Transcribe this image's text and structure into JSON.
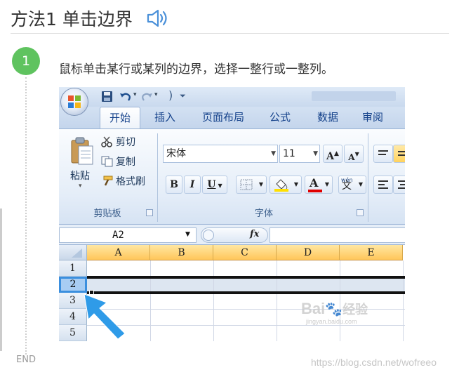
{
  "header": {
    "title": "方法1 单击边界"
  },
  "step": {
    "number": "1",
    "text": "鼠标单击某行或某列的边界，选择一整行或一整列。",
    "end_label": "END"
  },
  "watermark": {
    "url": "https://blog.csdn.net/wofreeo",
    "baidu": "Bai",
    "baidu_cn": "经验",
    "baidu_sub": "jingyan.baidu.com"
  },
  "excel": {
    "tabs": [
      "开始",
      "插入",
      "页面布局",
      "公式",
      "数据",
      "审阅"
    ],
    "active_tab": "开始",
    "clipboard": {
      "paste": "粘贴",
      "cut": "剪切",
      "copy": "复制",
      "format_painter": "格式刷",
      "group_label": "剪贴板"
    },
    "font": {
      "name": "宋体",
      "size": "11",
      "grow": "A",
      "shrink": "A",
      "bold": "B",
      "italic": "I",
      "underline": "U",
      "font_color": "A",
      "phonetic": "wén",
      "phonetic_char": "文",
      "group_label": "字体"
    },
    "formula_bar": {
      "namebox": "A2",
      "fx": "fx"
    },
    "columns": [
      "A",
      "B",
      "C",
      "D",
      "E"
    ],
    "rows": [
      "1",
      "2",
      "3",
      "4",
      "5"
    ],
    "selected_row": "2"
  },
  "colors": {
    "accent_green": "#5fc35f",
    "ribbon_text": "#15428b",
    "header_orange": "#ffc65a",
    "selection_blue": "#3b8fde",
    "arrow_blue": "#2f9be8"
  }
}
